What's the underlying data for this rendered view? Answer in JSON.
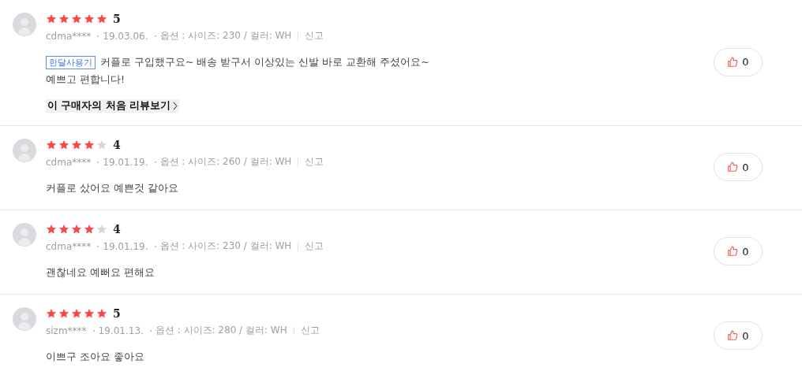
{
  "reviews": [
    {
      "stars": 5,
      "score": "5",
      "user": "cdma****",
      "date": "19.03.06.",
      "option": "옵션 : 사이즈: 230 / 컬러: WH",
      "report": "신고",
      "badge": "한달사용기",
      "body_lines": [
        "커플로 구입했구요~ 배송 받구서 이상있는 신발 바로 교환해 주셨어요~",
        "예쁘고 편합니다!"
      ],
      "first_review_link": "이 구매자의 처음 리뷰보기",
      "likes": "0"
    },
    {
      "stars": 4,
      "score": "4",
      "user": "cdma****",
      "date": "19.01.19.",
      "option": "옵션 : 사이즈: 260 / 컬러: WH",
      "report": "신고",
      "body_lines": [
        "커플로 샀어요 예쁜것 같아요"
      ],
      "likes": "0"
    },
    {
      "stars": 4,
      "score": "4",
      "user": "cdma****",
      "date": "19.01.19.",
      "option": "옵션 : 사이즈: 230 / 컬러: WH",
      "report": "신고",
      "body_lines": [
        "괜찮네요 예뻐요 편해요"
      ],
      "likes": "0"
    },
    {
      "stars": 5,
      "score": "5",
      "user": "sizm****",
      "date": "19.01.13.",
      "option": "옵션 : 사이즈: 280 / 컬러: WH",
      "report": "신고",
      "body_lines": [
        "이쁘구 조아요 좋아요"
      ],
      "likes": "0"
    }
  ]
}
